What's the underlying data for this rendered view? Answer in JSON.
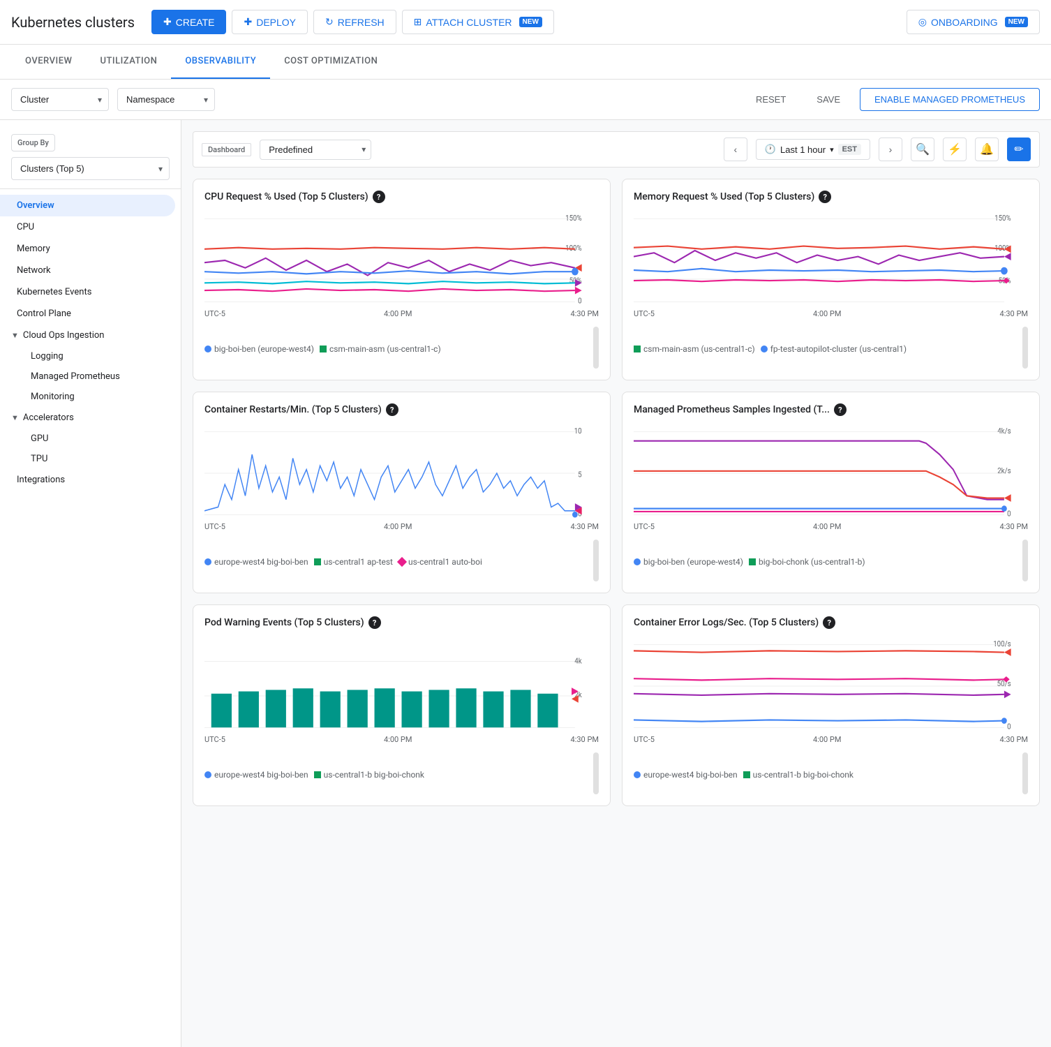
{
  "header": {
    "title": "Kubernetes clusters",
    "buttons": [
      {
        "label": "CREATE",
        "icon": "+",
        "type": "primary",
        "id": "create"
      },
      {
        "label": "DEPLOY",
        "icon": "+",
        "type": "secondary",
        "id": "deploy"
      },
      {
        "label": "REFRESH",
        "icon": "↻",
        "type": "secondary",
        "id": "refresh"
      },
      {
        "label": "ATTACH CLUSTER",
        "icon": "⊕",
        "type": "secondary",
        "id": "attach",
        "badge": "NEW"
      },
      {
        "label": "ONBOARDING",
        "icon": "○",
        "type": "secondary",
        "id": "onboarding",
        "badge": "NEW"
      }
    ]
  },
  "tabs": [
    {
      "label": "OVERVIEW",
      "active": false
    },
    {
      "label": "UTILIZATION",
      "active": false
    },
    {
      "label": "OBSERVABILITY",
      "active": true
    },
    {
      "label": "COST OPTIMIZATION",
      "active": false
    }
  ],
  "filters": {
    "cluster_label": "Cluster",
    "namespace_label": "Namespace",
    "reset_label": "RESET",
    "save_label": "SAVE",
    "enable_btn_label": "ENABLE MANAGED PROMETHEUS"
  },
  "sidebar": {
    "group_by_label": "Group By",
    "group_by_value": "Clusters (Top 5)",
    "nav_items": [
      {
        "label": "Overview",
        "active": true,
        "level": 1
      },
      {
        "label": "CPU",
        "active": false,
        "level": 1
      },
      {
        "label": "Memory",
        "active": false,
        "level": 1
      },
      {
        "label": "Network",
        "active": false,
        "level": 1
      },
      {
        "label": "Kubernetes Events",
        "active": false,
        "level": 1
      },
      {
        "label": "Control Plane",
        "active": false,
        "level": 1
      },
      {
        "label": "Cloud Ops Ingestion",
        "active": false,
        "level": 1,
        "expandable": true,
        "expanded": true
      },
      {
        "label": "Logging",
        "active": false,
        "level": 2
      },
      {
        "label": "Managed Prometheus",
        "active": false,
        "level": 2
      },
      {
        "label": "Monitoring",
        "active": false,
        "level": 2
      },
      {
        "label": "Accelerators",
        "active": false,
        "level": 1,
        "expandable": true,
        "expanded": true
      },
      {
        "label": "GPU",
        "active": false,
        "level": 2
      },
      {
        "label": "TPU",
        "active": false,
        "level": 2
      },
      {
        "label": "Integrations",
        "active": false,
        "level": 1
      }
    ]
  },
  "dashboard": {
    "field_label": "Dashboard",
    "predefined_label": "Predefined",
    "time_range": "Last 1 hour",
    "time_zone": "EST",
    "charts": [
      {
        "id": "cpu-request",
        "title": "CPU Request % Used (Top 5 Clusters)",
        "y_labels": [
          "150%",
          "100%",
          "50%",
          "0"
        ],
        "x_labels": [
          "UTC-5",
          "4:00 PM",
          "4:30 PM"
        ],
        "legend": [
          {
            "color": "#4285f4",
            "shape": "dot",
            "label": "big-boi-ben (europe-west4)"
          },
          {
            "color": "#0f9d58",
            "shape": "square",
            "label": "csm-main-asm (us-central1-c)"
          }
        ]
      },
      {
        "id": "memory-request",
        "title": "Memory Request % Used (Top 5 Clusters)",
        "y_labels": [
          "150%",
          "100%",
          "50%"
        ],
        "x_labels": [
          "UTC-5",
          "4:00 PM",
          "4:30 PM"
        ],
        "legend": [
          {
            "color": "#0f9d58",
            "shape": "square",
            "label": "csm-main-asm (us-central1-c)"
          },
          {
            "color": "#4285f4",
            "shape": "dot",
            "label": "fp-test-autopilot-cluster (us-central1)"
          }
        ]
      },
      {
        "id": "container-restarts",
        "title": "Container Restarts/Min. (Top 5 Clusters)",
        "y_labels": [
          "10",
          "5",
          "0"
        ],
        "x_labels": [
          "UTC-5",
          "4:00 PM",
          "4:30 PM"
        ],
        "legend": [
          {
            "color": "#4285f4",
            "shape": "dot",
            "label": "europe-west4 big-boi-ben"
          },
          {
            "color": "#0f9d58",
            "shape": "square",
            "label": "us-central1 ap-test"
          },
          {
            "color": "#e91e8c",
            "shape": "diamond",
            "label": "us-central1 auto-boi"
          }
        ]
      },
      {
        "id": "managed-prometheus",
        "title": "Managed Prometheus Samples Ingested (T...",
        "y_labels": [
          "4k/s",
          "2k/s",
          "0"
        ],
        "x_labels": [
          "UTC-5",
          "4:00 PM",
          "4:30 PM"
        ],
        "legend": [
          {
            "color": "#4285f4",
            "shape": "dot",
            "label": "big-boi-ben (europe-west4)"
          },
          {
            "color": "#0f9d58",
            "shape": "square",
            "label": "big-boi-chonk (us-central1-b)"
          }
        ]
      },
      {
        "id": "pod-warning",
        "title": "Pod Warning Events (Top 5 Clusters)",
        "y_labels": [
          "4k",
          "2k"
        ],
        "x_labels": [
          "UTC-5",
          "4:00 PM",
          "4:30 PM"
        ],
        "legend": [
          {
            "color": "#4285f4",
            "shape": "dot",
            "label": "europe-west4 big-boi-ben"
          },
          {
            "color": "#0f9d58",
            "shape": "square",
            "label": "us-central1-b big-boi-chonk"
          }
        ]
      },
      {
        "id": "container-error-logs",
        "title": "Container Error Logs/Sec. (Top 5 Clusters)",
        "y_labels": [
          "100/s",
          "50/s",
          "0"
        ],
        "x_labels": [
          "UTC-5",
          "4:00 PM",
          "4:30 PM"
        ],
        "legend": [
          {
            "color": "#4285f4",
            "shape": "dot",
            "label": "europe-west4 big-boi-ben"
          },
          {
            "color": "#0f9d58",
            "shape": "square",
            "label": "us-central1-b big-boi-chonk"
          }
        ]
      }
    ]
  }
}
